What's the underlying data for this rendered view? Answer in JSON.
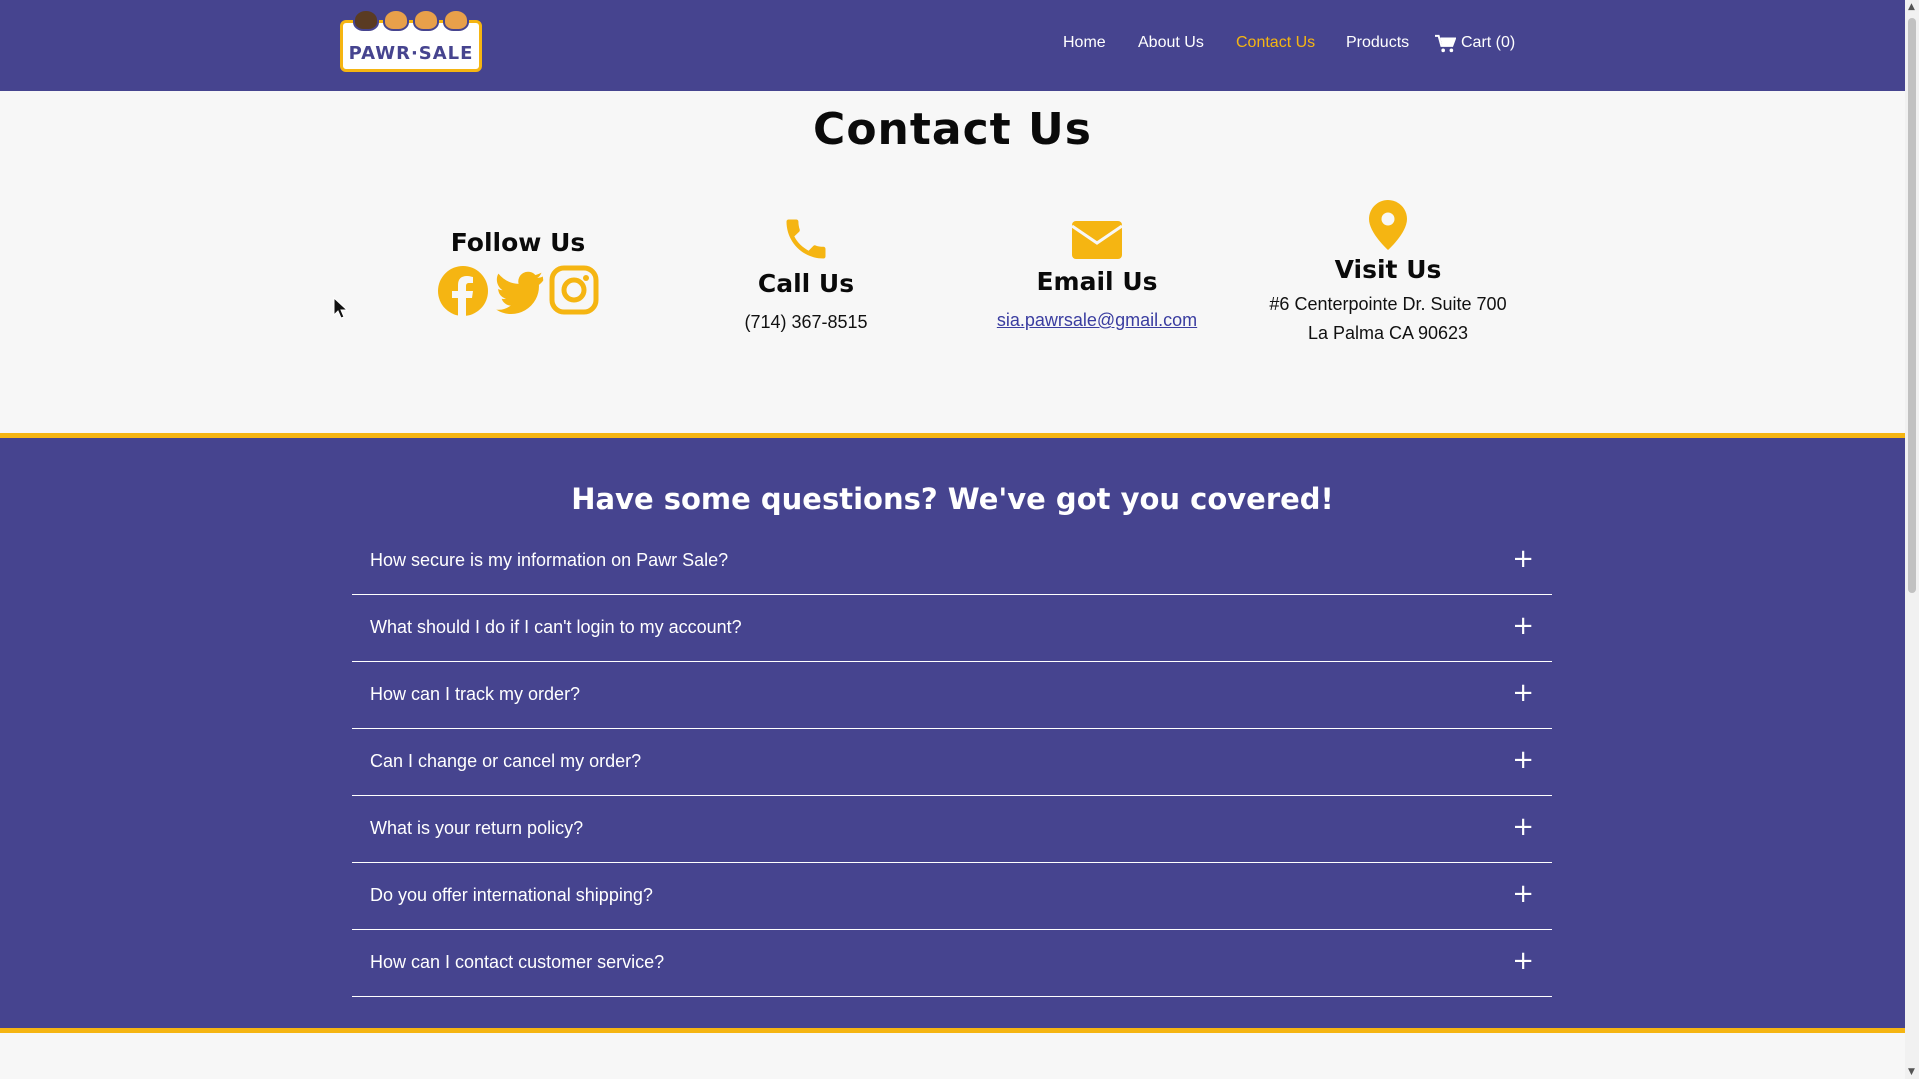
{
  "brand": {
    "logo_text": "PAWR·SALE"
  },
  "nav": {
    "home": "Home",
    "about": "About Us",
    "contact": "Contact Us",
    "products": "Products",
    "cart": "Cart (0)"
  },
  "colors": {
    "primary": "#46448f",
    "accent": "#f5b512",
    "background": "#f7f7f7"
  },
  "contact": {
    "title": "Contact Us",
    "follow": {
      "title": "Follow Us",
      "icons": [
        "facebook-icon",
        "twitter-icon",
        "instagram-icon"
      ]
    },
    "call": {
      "title": "Call Us",
      "phone": "(714) 367-8515"
    },
    "email": {
      "title": "Email Us",
      "address": "sia.pawrsale@gmail.com"
    },
    "visit": {
      "title": "Visit Us",
      "line1": "#6 Centerpointe Dr. Suite 700",
      "line2": "La Palma CA 90623"
    }
  },
  "faq": {
    "heading": "Have some questions? We've got you covered!",
    "items": [
      {
        "question": "How secure is my information on Pawr Sale?",
        "icon": "+"
      },
      {
        "question": "What should I do if I can't login to my account?",
        "icon": "+"
      },
      {
        "question": "How can I track my order?",
        "icon": "+"
      },
      {
        "question": "Can I change or cancel my order?",
        "icon": "+"
      },
      {
        "question": "What is your return policy?",
        "icon": "+"
      },
      {
        "question": "Do you offer international shipping?",
        "icon": "+"
      },
      {
        "question": "How can I contact customer service?",
        "icon": "+"
      }
    ]
  }
}
